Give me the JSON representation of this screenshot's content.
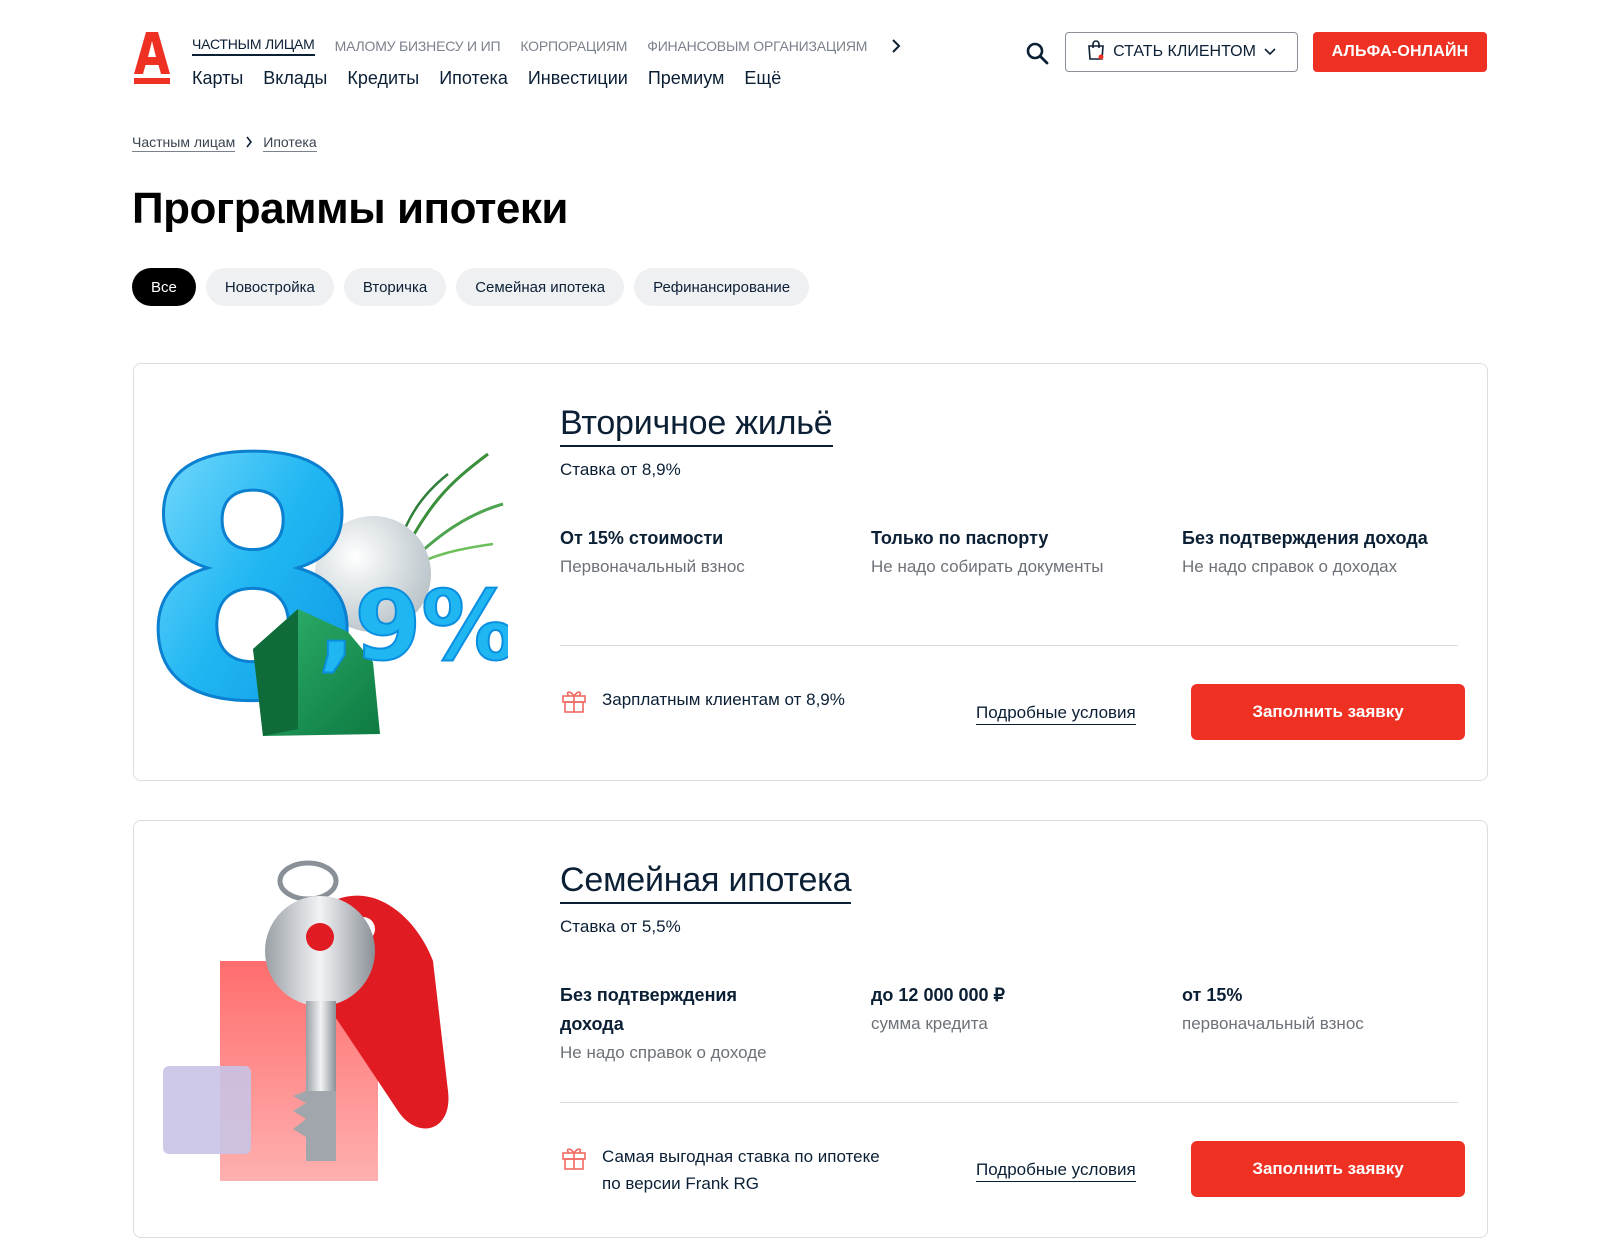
{
  "header": {
    "segments": [
      {
        "label": "ЧАСТНЫМ ЛИЦАМ",
        "active": true
      },
      {
        "label": "МАЛОМУ БИЗНЕСУ И ИП",
        "active": false
      },
      {
        "label": "КОРПОРАЦИЯМ",
        "active": false
      },
      {
        "label": "ФИНАНСОВЫМ ОРГАНИЗАЦИЯМ",
        "active": false
      }
    ],
    "menu": [
      "Карты",
      "Вклады",
      "Кредиты",
      "Ипотека",
      "Инвестиции",
      "Премиум",
      "Ещё"
    ],
    "client_button": "СТАТЬ КЛИЕНТОМ",
    "online_button": "АЛЬФА-ОНЛАЙН"
  },
  "breadcrumb": [
    "Частным лицам",
    "Ипотека"
  ],
  "page_title": "Программы ипотеки",
  "filters": [
    {
      "label": "Все",
      "active": true
    },
    {
      "label": "Новостройка",
      "active": false
    },
    {
      "label": "Вторичка",
      "active": false
    },
    {
      "label": "Семейная ипотека",
      "active": false
    },
    {
      "label": "Рефинансирование",
      "active": false
    }
  ],
  "cards": [
    {
      "title": "Вторичное жильё",
      "rate": "Ставка от 8,9%",
      "illustration_text": {
        "big": "8",
        "small": ",9%"
      },
      "features": [
        {
          "title": "От 15% стоимости",
          "desc": "Первоначальный взнос"
        },
        {
          "title": "Только по паспорту",
          "desc": "Не надо собирать документы"
        },
        {
          "title": "Без подтверждения дохода",
          "desc": "Не надо справок о доходах"
        }
      ],
      "bonus": "Зарплатным клиентам от 8,9%",
      "details_link": "Подробные условия",
      "apply_button": "Заполнить заявку"
    },
    {
      "title": "Семейная ипотека",
      "rate": "Ставка от 5,5%",
      "features": [
        {
          "title": "Без подтверждения дохода",
          "desc": "Не надо справок о доходе"
        },
        {
          "title": "до 12 000 000 ₽",
          "desc": "сумма кредита"
        },
        {
          "title": "от 15%",
          "desc": "первоначальный взнос"
        }
      ],
      "bonus": "Самая выгодная ставка по ипотеке по версии Frank RG",
      "details_link": "Подробные условия",
      "apply_button": "Заполнить заявку"
    }
  ],
  "colors": {
    "brand": "#ef3124",
    "text": "#0b1f35",
    "muted": "#6d7278",
    "chip_bg": "#eff0f2"
  },
  "icons": [
    "alfa-logo-icon",
    "chevron-right-icon",
    "search-icon",
    "bag-icon",
    "chevron-down-icon",
    "gift-icon"
  ]
}
